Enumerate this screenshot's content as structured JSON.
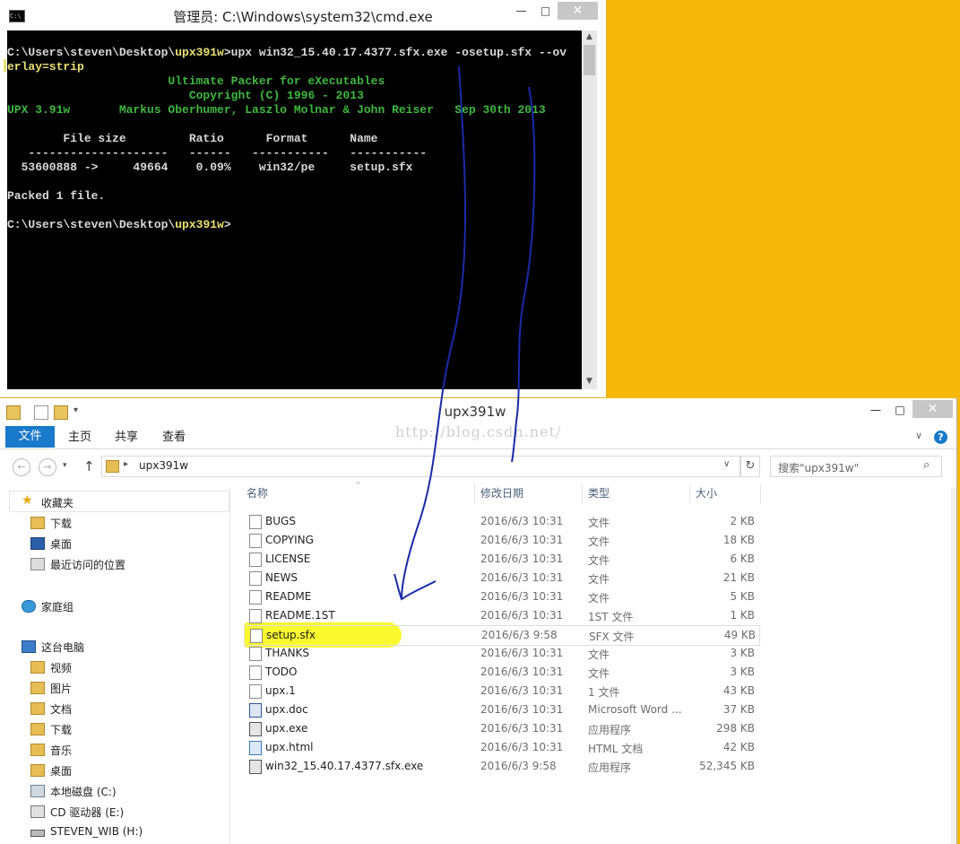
{
  "cmd": {
    "title": "管理员: C:\\Windows\\system32\\cmd.exe",
    "icon_text": "C:\\",
    "minimize": "—",
    "maximize": "□",
    "close": "✕",
    "lines": [
      {
        "prompt": "C:\\Users\\steven\\Desktop\\",
        "dir": "upx391w",
        "rest": ">upx win32_15.40.17.4377.sfx.exe -osetup.sfx --ov"
      },
      {
        "text": "erlay=strip"
      },
      {
        "text": "                       Ultimate Packer for eXecutables"
      },
      {
        "text": "                          Copyright (C) 1996 - 2013"
      },
      {
        "text": "UPX 3.91w       Markus Oberhumer, Laszlo Molnar & John Reiser   Sep 30th 2013"
      },
      {
        "text": ""
      },
      {
        "text": "        File size         Ratio      Format      Name"
      },
      {
        "text": "   --------------------   ------   -----------   -----------"
      },
      {
        "text": "  53600888 ->     49664    0.09%    win32/pe     setup.sfx"
      },
      {
        "text": ""
      },
      {
        "text": "Packed 1 file."
      },
      {
        "text": ""
      },
      {
        "prompt": "C:\\Users\\steven\\Desktop\\",
        "dir": "upx391w",
        "rest": ">"
      }
    ]
  },
  "explorer": {
    "title": "upx391w",
    "minimize": "—",
    "maximize": "□",
    "close": "✕",
    "tabs": [
      "文件",
      "主页",
      "共享",
      "查看"
    ],
    "watermark": "http://blog.csdn.net/",
    "address": "upx391w",
    "search_placeholder": "搜索\"upx391w\"",
    "nav": [
      {
        "label": "收藏夹",
        "icon": "star-icon"
      },
      {
        "label": "下载",
        "icon": "download-folder-icon"
      },
      {
        "label": "桌面",
        "icon": "desktop-icon"
      },
      {
        "label": "最近访问的位置",
        "icon": "recent-places-icon"
      },
      {
        "label": "家庭组",
        "icon": "homegroup-icon"
      },
      {
        "label": "这台电脑",
        "icon": "computer-icon"
      },
      {
        "label": "视频",
        "icon": "video-folder-icon"
      },
      {
        "label": "图片",
        "icon": "pictures-folder-icon"
      },
      {
        "label": "文档",
        "icon": "documents-folder-icon"
      },
      {
        "label": "下载",
        "icon": "download-folder-icon"
      },
      {
        "label": "音乐",
        "icon": "music-folder-icon"
      },
      {
        "label": "桌面",
        "icon": "desktop-folder-icon"
      },
      {
        "label": "本地磁盘 (C:)",
        "icon": "drive-icon"
      },
      {
        "label": "CD 驱动器 (E:)",
        "icon": "cd-drive-icon"
      },
      {
        "label": "STEVEN_WIB (H:)",
        "icon": "usb-drive-icon"
      }
    ],
    "columns": [
      "名称",
      "修改日期",
      "类型",
      "大小"
    ],
    "files": [
      {
        "name": "BUGS",
        "date": "2016/6/3 10:31",
        "type": "文件",
        "size": "2 KB",
        "icon": "file-icon"
      },
      {
        "name": "COPYING",
        "date": "2016/6/3 10:31",
        "type": "文件",
        "size": "18 KB",
        "icon": "file-icon"
      },
      {
        "name": "LICENSE",
        "date": "2016/6/3 10:31",
        "type": "文件",
        "size": "6 KB",
        "icon": "file-icon"
      },
      {
        "name": "NEWS",
        "date": "2016/6/3 10:31",
        "type": "文件",
        "size": "21 KB",
        "icon": "file-icon"
      },
      {
        "name": "README",
        "date": "2016/6/3 10:31",
        "type": "文件",
        "size": "5 KB",
        "icon": "file-icon"
      },
      {
        "name": "README.1ST",
        "date": "2016/6/3 10:31",
        "type": "1ST 文件",
        "size": "1 KB",
        "icon": "file-icon"
      },
      {
        "name": "setup.sfx",
        "date": "2016/6/3 9:58",
        "type": "SFX 文件",
        "size": "49 KB",
        "icon": "file-icon"
      },
      {
        "name": "THANKS",
        "date": "2016/6/3 10:31",
        "type": "文件",
        "size": "3 KB",
        "icon": "file-icon"
      },
      {
        "name": "TODO",
        "date": "2016/6/3 10:31",
        "type": "文件",
        "size": "3 KB",
        "icon": "file-icon"
      },
      {
        "name": "upx.1",
        "date": "2016/6/3 10:31",
        "type": "1 文件",
        "size": "43 KB",
        "icon": "file-icon"
      },
      {
        "name": "upx.doc",
        "date": "2016/6/3 10:31",
        "type": "Microsoft Word ...",
        "size": "37 KB",
        "icon": "word-doc-icon"
      },
      {
        "name": "upx.exe",
        "date": "2016/6/3 10:31",
        "type": "应用程序",
        "size": "298 KB",
        "icon": "exe-icon"
      },
      {
        "name": "upx.html",
        "date": "2016/6/3 10:31",
        "type": "HTML 文档",
        "size": "42 KB",
        "icon": "html-doc-icon"
      },
      {
        "name": "win32_15.40.17.4377.sfx.exe",
        "date": "2016/6/3 9:58",
        "type": "应用程序",
        "size": "52,345 KB",
        "icon": "exe-icon"
      }
    ]
  },
  "colors": {
    "background": "#f7b80a",
    "console_bg": "#000000",
    "console_white": "#d8d8d8",
    "console_yellow": "#e8e070",
    "console_green": "#3fb83f",
    "accent": "#1979ca",
    "highlight": "#f8f81c",
    "annotation": "#1a2ba8"
  }
}
